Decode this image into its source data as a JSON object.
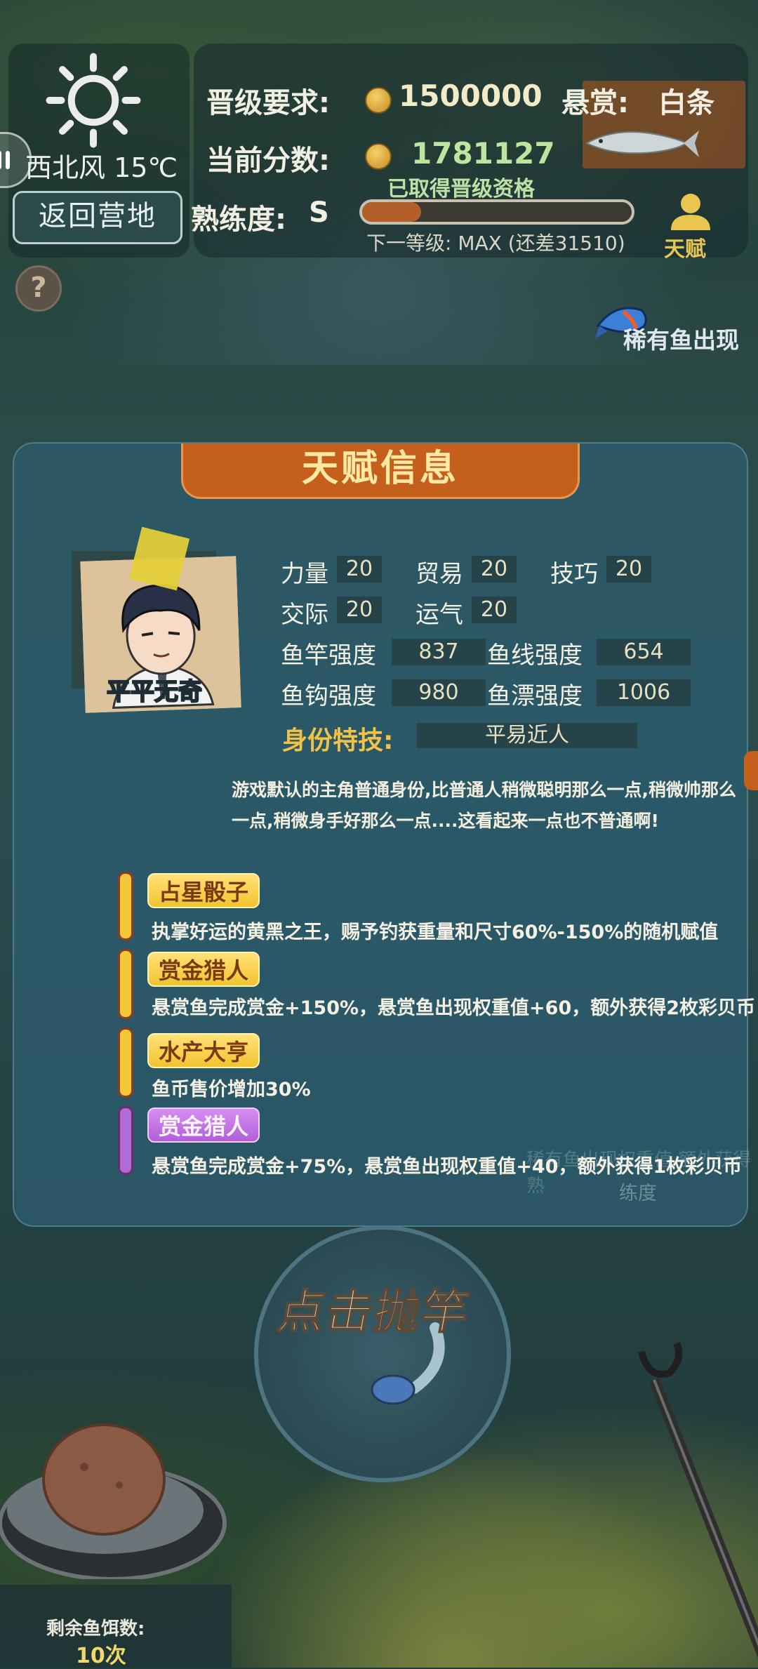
{
  "weather": {
    "wind": "西北风 15℃",
    "back_label": "返回营地",
    "help_label": "?"
  },
  "status": {
    "req_label": "晋级要求:",
    "req_value": "1500000",
    "bounty_label": "悬赏:",
    "bounty_fish": "白条",
    "score_label": "当前分数:",
    "score_value": "1781127",
    "qualified_note": "已取得晋级资格",
    "proficiency_label": "熟练度:",
    "proficiency_value": "S",
    "exp_progress_pct": 22,
    "next_level": "下一等级: MAX (还差31510)",
    "talent_label": "天赋",
    "rare_fish_label": "稀有鱼出现"
  },
  "talent": {
    "title": "天赋信息",
    "portrait_name": "平平无奇",
    "stats": [
      {
        "label": "力量",
        "value": "20"
      },
      {
        "label": "贸易",
        "value": "20"
      },
      {
        "label": "技巧",
        "value": "20"
      },
      {
        "label": "交际",
        "value": "20"
      },
      {
        "label": "运气",
        "value": "20"
      }
    ],
    "gear": [
      {
        "label": "鱼竿强度",
        "value": "837"
      },
      {
        "label": "鱼线强度",
        "value": "654"
      },
      {
        "label": "鱼钩强度",
        "value": "980"
      },
      {
        "label": "鱼漂强度",
        "value": "1006"
      }
    ],
    "identity_label": "身份特技:",
    "identity_value": "平易近人",
    "description": "游戏默认的主角普通身份,比普通人稍微聪明那么一点,稍微帅那么一点,稍微身手好那么一点....这看起来一点也不普通啊!",
    "skills": [
      {
        "name": "占星骰子",
        "desc": "执掌好运的黄黑之王，赐予钓获重量和尺寸60%-150%的随机赋值"
      },
      {
        "name": "赏金猎人",
        "desc": "悬赏鱼完成赏金+150%，悬赏鱼出现权重值+60，额外获得2枚彩贝币"
      },
      {
        "name": "水产大亨",
        "desc": "鱼币售价增加30%"
      },
      {
        "name": "赏金猎人",
        "desc": "悬赏鱼完成赏金+75%，悬赏鱼出现权重值+40，额外获得1枚彩贝币"
      }
    ],
    "faded_text": "稀有鱼出现权重值 额外获得熟",
    "faded_text2": "练度"
  },
  "cast": {
    "label": "点击抛竿"
  },
  "bait": {
    "label": "剩余鱼饵数:",
    "count": "10次"
  },
  "colors": {
    "accent_orange": "#c5601c",
    "gold": "#f2c838",
    "panel": "#2c5c6c",
    "purple": "#b06bd6"
  }
}
